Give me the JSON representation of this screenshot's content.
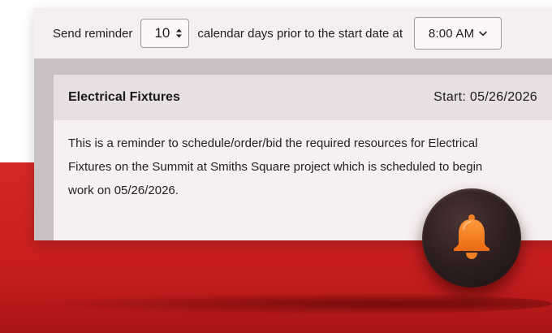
{
  "reminder": {
    "prefix_label": "Send reminder",
    "days_value": "10",
    "middle_label": "calendar days prior to the start date at",
    "time_value": "8:00 AM"
  },
  "card": {
    "title": "Electrical Fixtures",
    "start": "Start: 05/26/2026",
    "body": "This is a reminder to schedule/order/bid the required resources for Electrical Fixtures on the Summit at Smiths Square project which is scheduled to begin work on 05/26/2026."
  },
  "colors": {
    "brand_red": "#cc2222",
    "bell_orange": "#f07f22",
    "badge_dark": "#2c1d1e"
  },
  "icons": {
    "stepper": "up-down-arrows-icon",
    "select": "chevron-down-icon",
    "badge": "bell-icon"
  }
}
